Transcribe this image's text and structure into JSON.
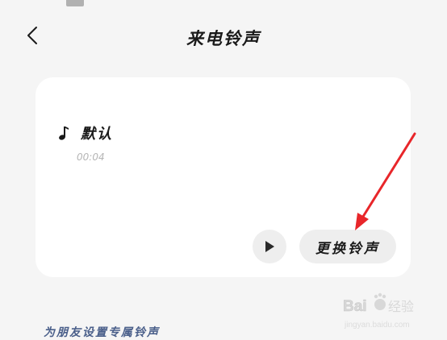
{
  "header": {
    "title": "来电铃声",
    "back_icon": "chevron-left-icon"
  },
  "ringtone": {
    "icon": "music-note-icon",
    "name": "默认",
    "duration": "00:04"
  },
  "actions": {
    "play_icon": "play-icon",
    "change_label": "更换铃声"
  },
  "section_link": "为朋友设置专属铃声",
  "annotation": {
    "arrow_color": "#e8262a"
  },
  "watermark": {
    "brand": "Bai",
    "brand_suffix": "经验",
    "subtext": "jingyan.baidu.com"
  },
  "colors": {
    "background": "#f5f5f5",
    "card": "#ffffff",
    "button_bg": "#eeeeee",
    "link": "#4a5f8a"
  }
}
